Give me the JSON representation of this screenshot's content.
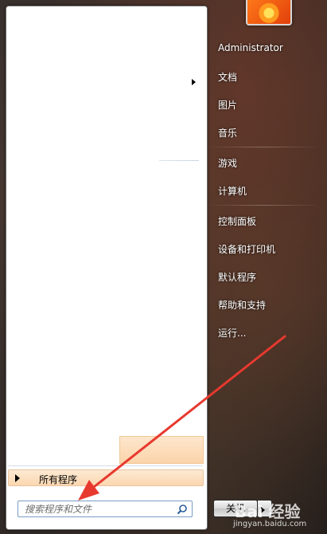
{
  "start_menu": {
    "all_programs_label": "所有程序",
    "search_placeholder": "搜索程序和文件",
    "user_name": "Administrator",
    "right_items": [
      {
        "label": "文档"
      },
      {
        "label": "图片"
      },
      {
        "label": "音乐"
      },
      {
        "label": "游戏"
      },
      {
        "label": "计算机"
      },
      {
        "label": "控制面板"
      },
      {
        "label": "设备和打印机"
      },
      {
        "label": "默认程序"
      },
      {
        "label": "帮助和支持"
      },
      {
        "label": "运行..."
      }
    ],
    "shutdown_label": "关机"
  },
  "watermark": {
    "logo_text": "Bai 经验",
    "url": "jingyan.baidu.com"
  },
  "icons": {
    "search": "search-icon",
    "avatar": "flower-avatar",
    "annotation": "red-arrow-icon"
  },
  "colors": {
    "annotation_arrow": "#e8392f",
    "highlight": "#fbd4aa",
    "search_border": "#7a9bc4"
  }
}
